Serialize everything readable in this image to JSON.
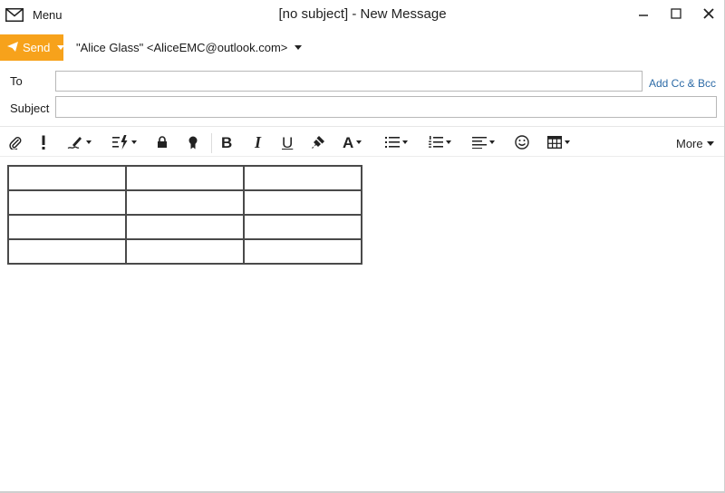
{
  "window": {
    "menu_label": "Menu",
    "title": "[no subject] - New Message"
  },
  "compose": {
    "send_label": "Send",
    "from": "\"Alice Glass\" <AliceEMC@outlook.com>",
    "to_label": "To",
    "to_value": "",
    "add_cc_bcc": "Add Cc & Bcc",
    "subject_label": "Subject",
    "subject_value": ""
  },
  "toolbar": {
    "bold": "B",
    "italic": "I",
    "underline": "U",
    "font_color": "A",
    "more_label": "More"
  },
  "body_table": {
    "rows": 4,
    "cols": 3
  },
  "colors": {
    "accent": "#f7a21b",
    "link": "#2c6aa6"
  }
}
